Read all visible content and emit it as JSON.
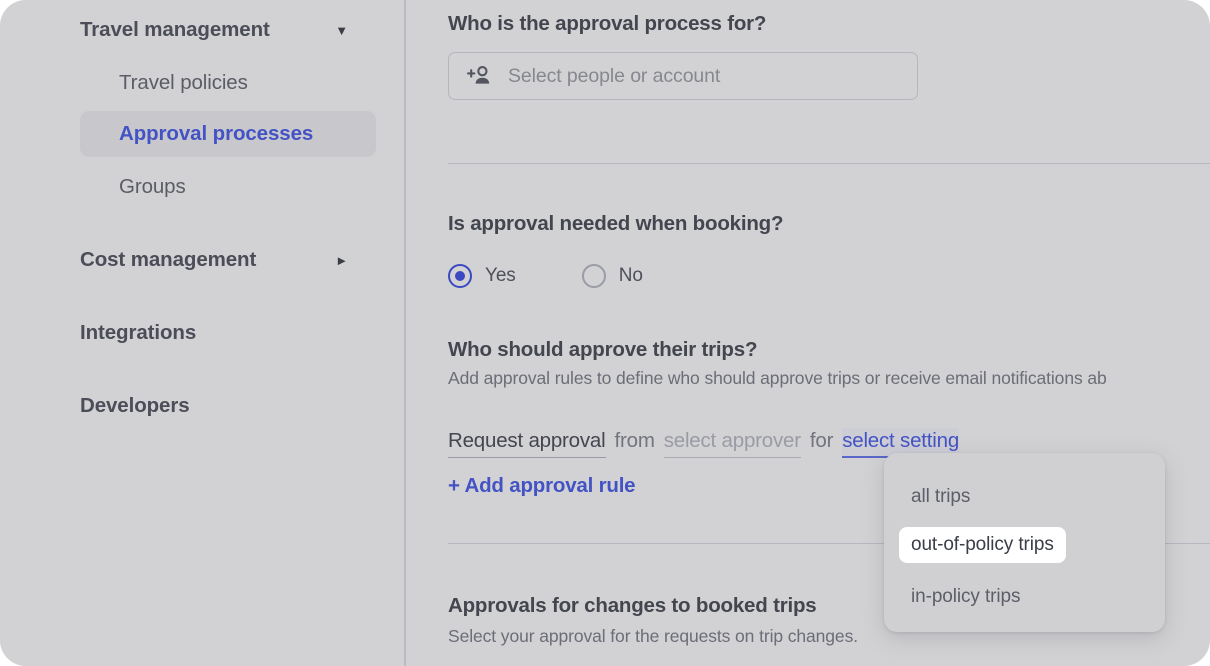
{
  "sidebar": {
    "groups": [
      {
        "label": "Travel management",
        "caret": "▼",
        "caret_name": "chevron-down-icon"
      }
    ],
    "sub_items": [
      {
        "label": "Travel policies",
        "active": false
      },
      {
        "label": "Approval processes",
        "active": true
      },
      {
        "label": "Groups",
        "active": false
      }
    ],
    "collapsed_group": {
      "label": "Cost management",
      "caret": "►",
      "caret_name": "chevron-right-icon"
    },
    "top_items": [
      {
        "label": "Integrations"
      },
      {
        "label": "Developers"
      }
    ]
  },
  "main": {
    "section_audience": {
      "title": "Who is the approval process for?",
      "people_select_placeholder": "Select people or account",
      "people_select_icon": "person-add-icon"
    },
    "section_needed": {
      "title": "Is approval needed when booking?",
      "options": [
        {
          "label": "Yes",
          "selected": true
        },
        {
          "label": "No",
          "selected": false
        }
      ]
    },
    "section_approvers": {
      "title": "Who should approve their trips?",
      "description": "Add approval rules to define who should approve trips or receive email notifications ab",
      "rule": {
        "action": "Request approval",
        "connector_from": "from",
        "approver_placeholder": "select approver",
        "connector_for": "for",
        "setting_placeholder": "select setting"
      },
      "add_rule_label": "+ Add approval rule"
    },
    "section_changes": {
      "title": "Approvals for changes to booked trips",
      "description": "Select your approval for the requests on trip changes."
    }
  },
  "dropdown": {
    "name": "setting-options-dropdown",
    "options": [
      {
        "label": "all trips",
        "highlighted": false
      },
      {
        "label": "out-of-policy trips",
        "highlighted": true
      },
      {
        "label": "in-policy trips",
        "highlighted": false
      }
    ]
  },
  "colors": {
    "background": "#d2d2d4",
    "accent": "#4453c4",
    "text_strong": "#43454f",
    "text_muted": "#6b6d77",
    "divider": "#b6b8bf",
    "highlight_bg": "#ffffff"
  }
}
